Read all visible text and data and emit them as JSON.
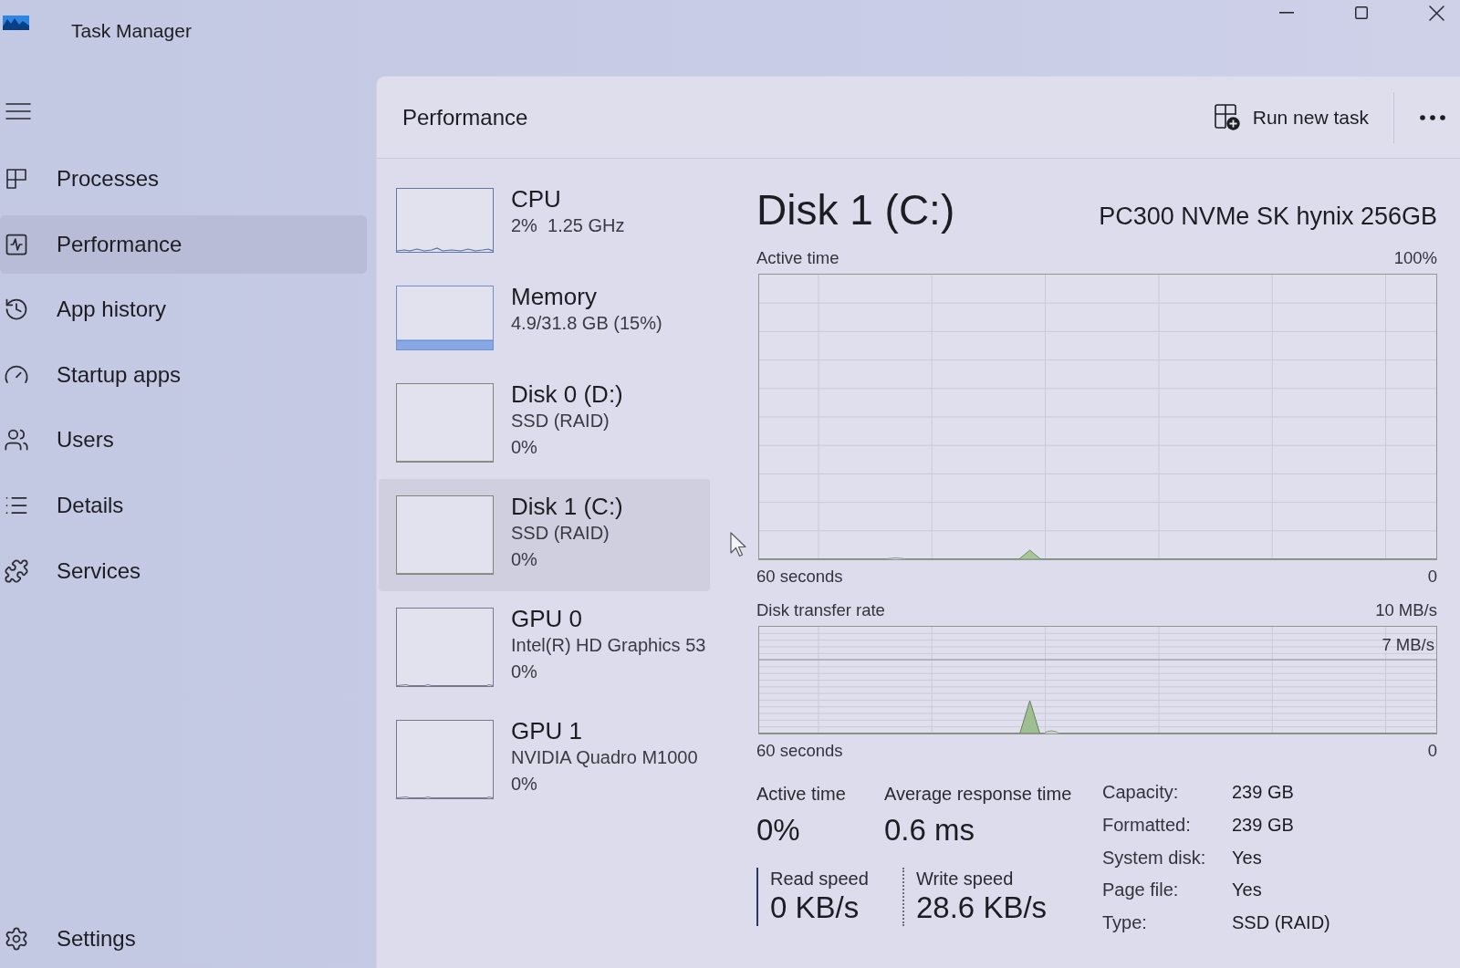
{
  "window": {
    "title": "Task Manager"
  },
  "sidebar": {
    "items": [
      {
        "label": "Processes",
        "selected": false
      },
      {
        "label": "Performance",
        "selected": true
      },
      {
        "label": "App history",
        "selected": false
      },
      {
        "label": "Startup apps",
        "selected": false
      },
      {
        "label": "Users",
        "selected": false
      },
      {
        "label": "Details",
        "selected": false
      },
      {
        "label": "Services",
        "selected": false
      }
    ],
    "settings": {
      "label": "Settings"
    }
  },
  "header": {
    "title": "Performance",
    "run_task": "Run new task"
  },
  "devices": [
    {
      "kind": "cpu",
      "name": "CPU",
      "details": [
        "2%  1.25 GHz"
      ],
      "selected": false
    },
    {
      "kind": "memory",
      "name": "Memory",
      "details": [
        "4.9/31.8 GB (15%)"
      ],
      "selected": false
    },
    {
      "kind": "disk",
      "name": "Disk 0 (D:)",
      "details": [
        "SSD (RAID)",
        "0%"
      ],
      "selected": false
    },
    {
      "kind": "disk",
      "name": "Disk 1 (C:)",
      "details": [
        "SSD (RAID)",
        "0%"
      ],
      "selected": true
    },
    {
      "kind": "gpu",
      "name": "GPU 0",
      "details": [
        "Intel(R) HD Graphics 53",
        "0%"
      ],
      "selected": false
    },
    {
      "kind": "gpu",
      "name": "GPU 1",
      "details": [
        "NVIDIA Quadro M1000",
        "0%"
      ],
      "selected": false
    }
  ],
  "detail": {
    "title": "Disk 1 (C:)",
    "model": "PC300 NVMe SK hynix 256GB",
    "graphs": [
      {
        "kind": "active",
        "label": "Active time",
        "max": "100%",
        "time_span": "60 seconds",
        "end": "0"
      },
      {
        "kind": "transfer",
        "label": "Disk transfer rate",
        "max": "10 MB/s",
        "scale_mark": "7 MB/s",
        "time_span": "60 seconds",
        "end": "0"
      }
    ],
    "stats": [
      {
        "label": "Active time",
        "value": "0%"
      },
      {
        "label": "Average response time",
        "value": "0.6 ms"
      }
    ],
    "speeds": [
      {
        "kind": "read",
        "label": "Read speed",
        "value": "0 KB/s"
      },
      {
        "kind": "write",
        "label": "Write speed",
        "value": "28.6 KB/s"
      }
    ],
    "properties": [
      {
        "label": "Capacity:",
        "value": "239 GB"
      },
      {
        "label": "Formatted:",
        "value": "239 GB"
      },
      {
        "label": "System disk:",
        "value": "Yes"
      },
      {
        "label": "Page file:",
        "value": "Yes"
      },
      {
        "label": "Type:",
        "value": "SSD (RAID)"
      }
    ]
  }
}
